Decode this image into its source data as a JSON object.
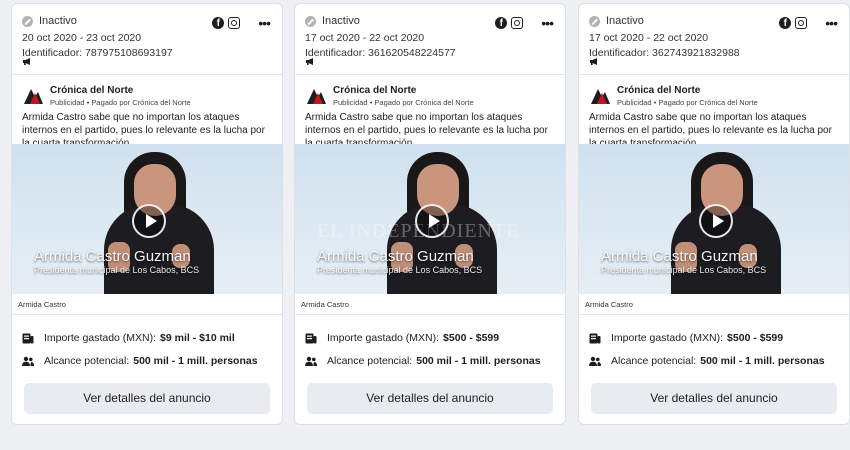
{
  "cards": [
    {
      "status": "Inactivo",
      "dates": "20 oct 2020 - 23 oct 2020",
      "identifier": "Identificador: 787975108693197",
      "advertiser": "Crónica del Norte",
      "sponsored": "Publicidad • Pagado por Crónica del Norte",
      "ad_text": "Armida Castro sabe que no importan los ataques internos en el partido, pues lo relevante es la lucha por la cuarta transformación.",
      "video_name": "Armida Castro Guzman",
      "video_role": "Presidenta municipal de Los Cabos, BCS",
      "watermark": "",
      "caption": "Armida Castro",
      "spent_label": "Importe gastado (MXN):",
      "spent_value": "$9 mil - $10 mil",
      "reach_label": "Alcance potencial:",
      "reach_value": "500 mil - 1 mill. personas",
      "button": "Ver detalles del anuncio"
    },
    {
      "status": "Inactivo",
      "dates": "17 oct 2020 - 22 oct 2020",
      "identifier": "Identificador: 361620548224577",
      "advertiser": "Crónica del Norte",
      "sponsored": "Publicidad • Pagado por Crónica del Norte",
      "ad_text": "Armida Castro sabe que no importan los ataques internos en el partido, pues lo relevante es la lucha por la cuarta transformación.",
      "video_name": "Armida Castro Guzman",
      "video_role": "Presidenta municipal de Los Cabos, BCS",
      "watermark": "EL INDEPENDIENTE",
      "caption": "Armida Castro",
      "spent_label": "Importe gastado (MXN):",
      "spent_value": "$500 - $599",
      "reach_label": "Alcance potencial:",
      "reach_value": "500 mil - 1 mill. personas",
      "button": "Ver detalles del anuncio"
    },
    {
      "status": "Inactivo",
      "dates": "17 oct 2020 - 22 oct 2020",
      "identifier": "Identificador: 362743921832988",
      "advertiser": "Crónica del Norte",
      "sponsored": "Publicidad • Pagado por Crónica del Norte",
      "ad_text": "Armida Castro sabe que no importan los ataques internos en el partido, pues lo relevante es la lucha por la cuarta transformación.",
      "video_name": "Armida Castro Guzman",
      "video_role": "Presidenta municipal de Los Cabos, BCS",
      "watermark": "",
      "caption": "Armida Castro",
      "spent_label": "Importe gastado (MXN):",
      "spent_value": "$500 - $599",
      "reach_label": "Alcance potencial:",
      "reach_value": "500 mil - 1 mill. personas",
      "button": "Ver detalles del anuncio"
    }
  ],
  "icons": {
    "status": "inactive-icon",
    "platform_1": "facebook-icon",
    "platform_2": "instagram-icon",
    "menu": "more-icon",
    "ad_type": "megaphone-icon",
    "spent": "receipt-icon",
    "reach": "people-icon"
  },
  "colors": {
    "page_bg": "#eef0f3",
    "button_bg": "#e8ecf0",
    "logo_red": "#c0171c"
  }
}
